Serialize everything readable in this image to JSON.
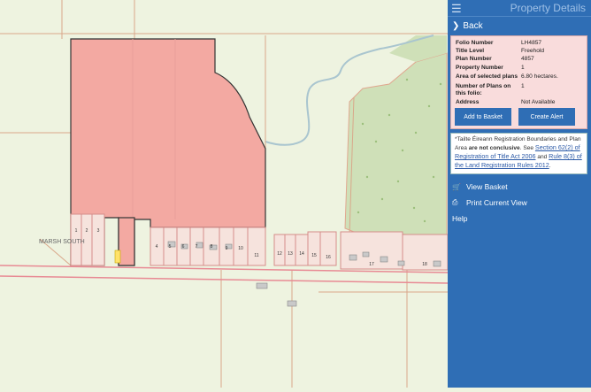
{
  "panel": {
    "title": "Property Details",
    "back_label": "Back"
  },
  "details": {
    "rows": [
      {
        "key": "Folio Number",
        "value": "LH4857"
      },
      {
        "key": "Title Level",
        "value": "Freehold"
      },
      {
        "key": "Plan Number",
        "value": "4857"
      },
      {
        "key": "Property Number",
        "value": "1"
      },
      {
        "key": "Area of selected plans",
        "value": "6.80 hectares."
      },
      {
        "key": "Number of Plans on this folio:",
        "value": "1"
      },
      {
        "key": "Address",
        "value": "Not Available"
      }
    ],
    "add_to_basket": "Add to Basket",
    "create_alert": "Create Alert"
  },
  "disclaimer": {
    "prefix": "*Tailte Éireann Registration Boundaries and Plan Area ",
    "bold": "are not conclusive",
    "mid": ". See ",
    "link1": "Section 62(2) of Registration of Title Act 2006",
    "and": " and ",
    "link2": "Rule 8(3) of the Land Registration Rules 2012",
    "end": "."
  },
  "nav": {
    "view_basket": "View Basket",
    "print_view": "Print Current View",
    "help": "Help"
  },
  "map": {
    "townland_label": "MARSH SOUTH",
    "plot_numbers": [
      "1",
      "2",
      "3",
      "4",
      "5",
      "6",
      "7",
      "8",
      "9",
      "10",
      "11",
      "12",
      "13",
      "14",
      "15",
      "16",
      "17",
      "18"
    ]
  },
  "colors": {
    "panel_bg": "#2f6eb5",
    "selected_fill": "#f3a9a2",
    "map_bg": "#eef3e0",
    "forest": "#cfe0b8",
    "road": "#e88a94"
  }
}
